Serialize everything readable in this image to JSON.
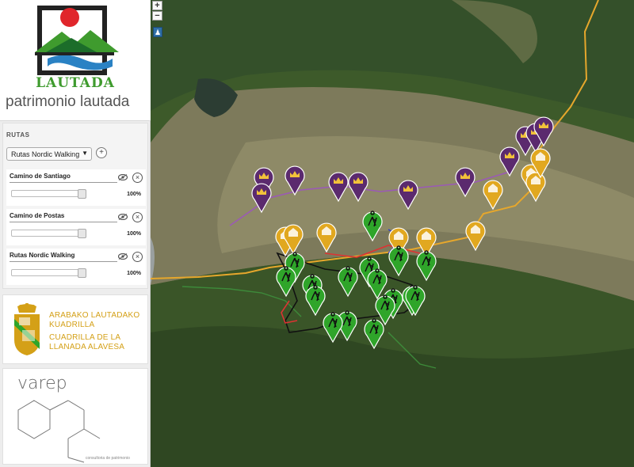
{
  "brand": {
    "logo_word": "LAUTADA",
    "site_title": "patrimonio lautada"
  },
  "rutas": {
    "panel_title": "RUTAS",
    "selected_route": "Rutas Nordic Walking",
    "layers": [
      {
        "name": "Camino de Santiago",
        "opacity_label": "100%",
        "opacity": 1.0
      },
      {
        "name": "Camino de Postas",
        "opacity_label": "100%",
        "opacity": 1.0
      },
      {
        "name": "Rutas Nordic Walking",
        "opacity_label": "100%",
        "opacity": 1.0
      }
    ]
  },
  "cuadrilla": {
    "line1": "ARABAKO LAUTADAKO",
    "line2": "KUADRILLA",
    "line3": "CUADRILLA DE LA",
    "line4": "LLANADA ALAVESA"
  },
  "varep": {
    "name": "varep",
    "tagline": "consultoria de patrimonio"
  },
  "map_controls": {
    "zoom_in": "+",
    "zoom_out": "−"
  },
  "colors": {
    "camino_santiago_marker": "#5b2a6e",
    "camino_postas_marker": "#e1a820",
    "nordic_walking_marker": "#2fa52a",
    "accent_green": "#3f9b2e",
    "cuadrilla_gold": "#d4a017"
  }
}
